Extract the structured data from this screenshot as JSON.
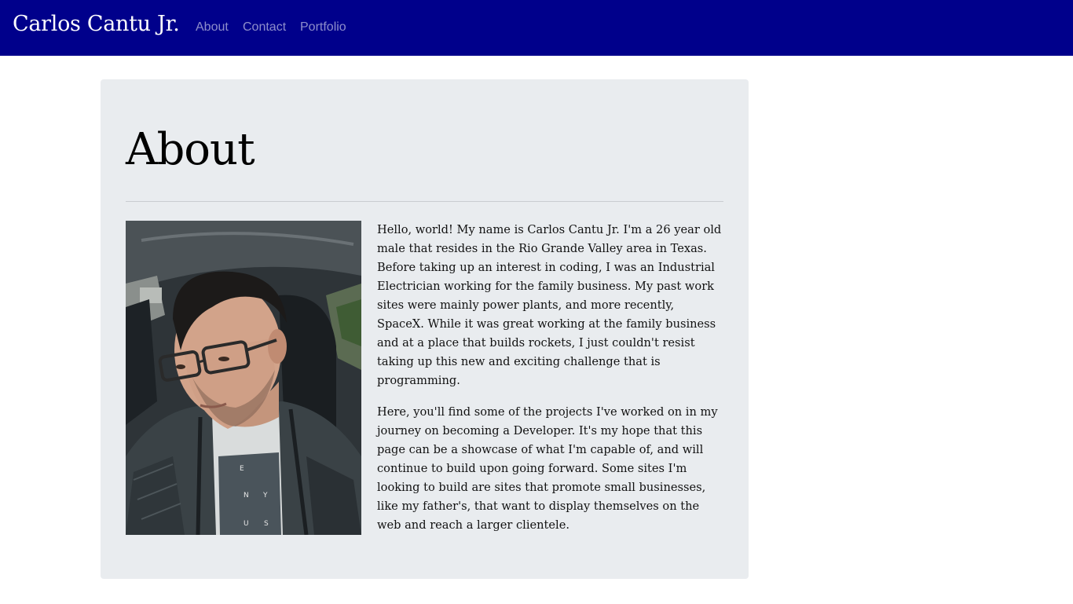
{
  "navbar": {
    "brand": "Carlos Cantu Jr.",
    "links": [
      "About",
      "Contact",
      "Portfolio"
    ],
    "background": "#00008b"
  },
  "main": {
    "title": "About",
    "paragraphs": [
      "Hello, world! My name is Carlos Cantu Jr. I'm a 26 year old male that resides in the Rio Grande Valley area in Texas. Before taking up an interest in coding, I was an Industrial Electrician working for the family business. My past work sites were mainly power plants, and more recently, SpaceX. While it was great working at the family business and at a place that builds rockets, I just couldn't resist taking up this new and exciting challenge that is programming.",
      "Here, you'll find some of the projects I've worked on in my journey on becoming a Developer. It's my hope that this page can be a showcase of what I'm capable of, and will continue to build upon going forward. Some sites I'm looking to build are sites that promote small businesses, like my father's, that want to display themselves on the web and reach a larger clientele."
    ],
    "panel_background": "#e9ecef"
  }
}
